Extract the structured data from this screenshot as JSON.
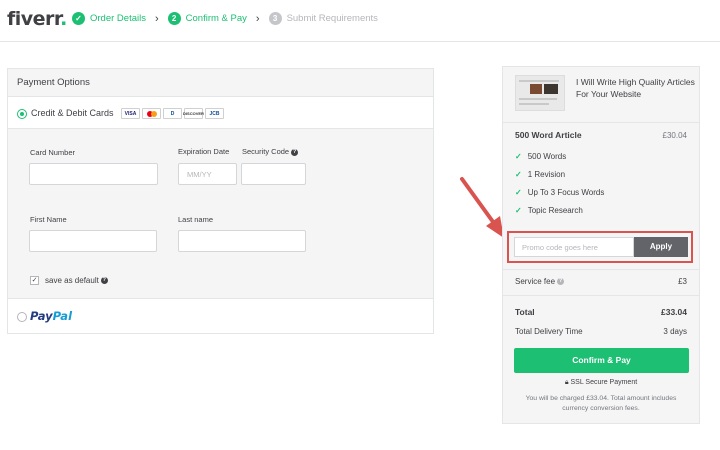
{
  "header": {
    "logo_text": "fiverr",
    "logo_dot": ".",
    "steps": [
      {
        "number": "✓",
        "label": "Order Details",
        "state": "done"
      },
      {
        "number": "2",
        "label": "Confirm & Pay",
        "state": "active"
      },
      {
        "number": "3",
        "label": "Submit Requirements",
        "state": "pending"
      }
    ],
    "separator": "›"
  },
  "payment": {
    "title": "Payment Options",
    "card_option_label": "Credit & Debit Cards",
    "card_brands": {
      "visa": "VISA",
      "diners": "D",
      "discover": "DISCOVER",
      "jcb": "JCB"
    },
    "card_number_label": "Card Number",
    "expiration_label": "Expiration Date",
    "expiration_placeholder": "MM/YY",
    "security_code_label": "Security Code",
    "first_name_label": "First Name",
    "last_name_label": "Last name",
    "save_default_label": "save as default",
    "save_default_checked": "✓",
    "paypal_dark": "Pay",
    "paypal_light": "Pal"
  },
  "order": {
    "gig_title": "I Will Write High Quality Articles For Your Website",
    "package_name": "500 Word Article",
    "package_price": "£30.04",
    "features": [
      "500 Words",
      "1 Revision",
      "Up To 3 Focus Words",
      "Topic Research"
    ],
    "promo_placeholder": "Promo code goes here",
    "apply_label": "Apply",
    "service_fee_label": "Service fee",
    "service_fee_value": "£3",
    "total_label": "Total",
    "total_value": "£33.04",
    "delivery_label": "Total Delivery Time",
    "delivery_value": "3 days",
    "confirm_label": "Confirm & Pay",
    "ssl_label": "SSL Secure Payment",
    "charge_note": "You will be charged £33.04. Total amount includes currency conversion fees."
  },
  "colors": {
    "brand_green": "#1dbf73",
    "apply_button": "#62646a",
    "highlight_red": "#d9534f"
  }
}
